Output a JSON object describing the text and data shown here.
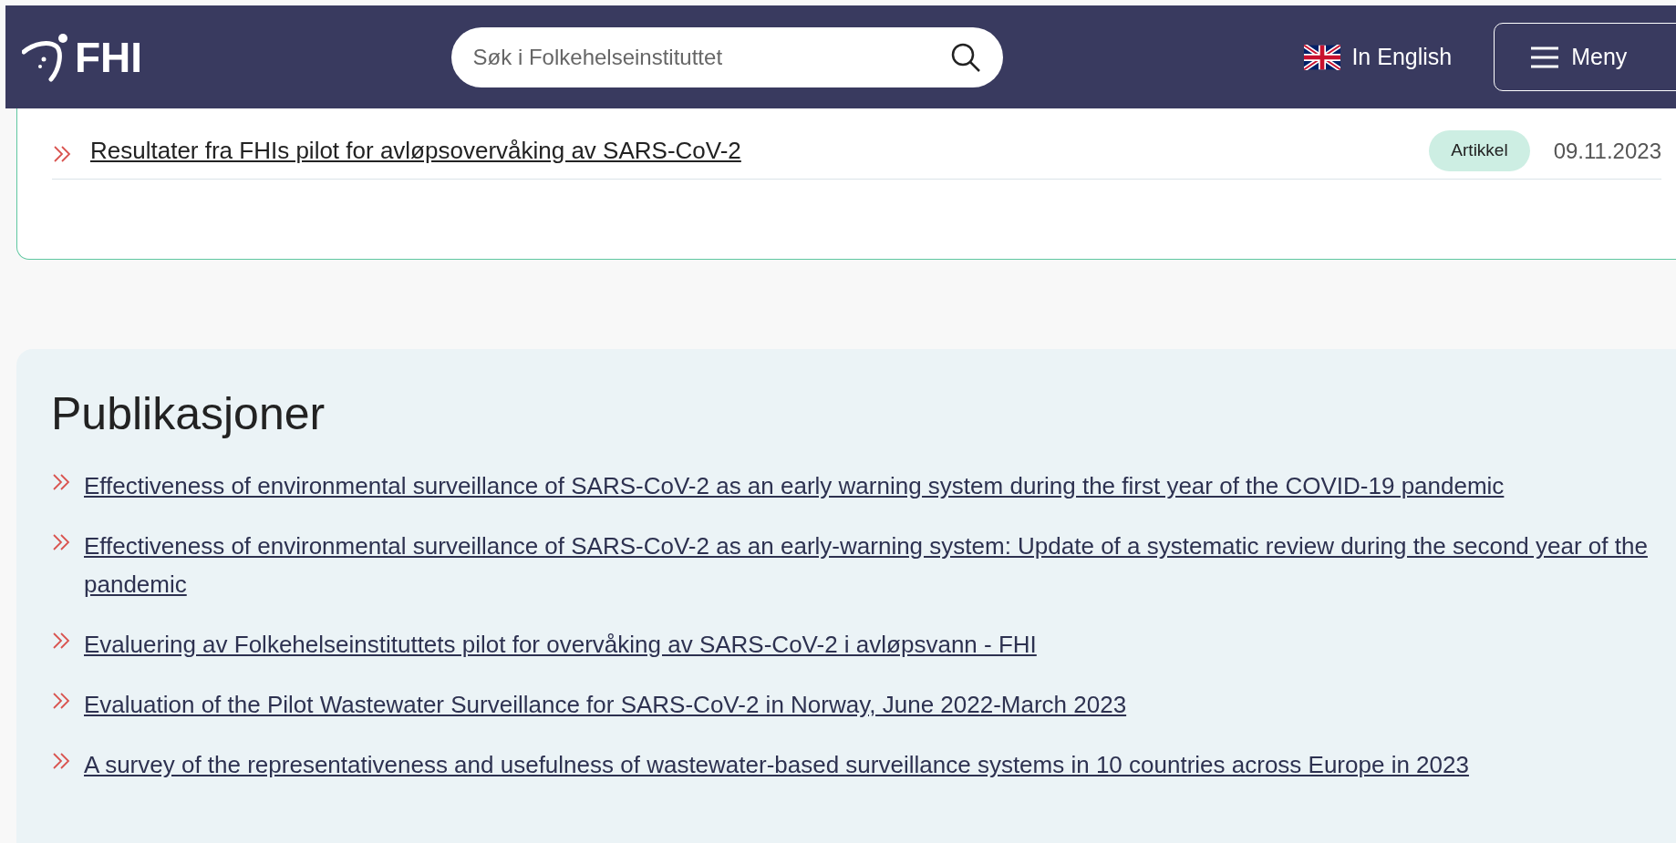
{
  "header": {
    "logo": "FHI",
    "search": {
      "placeholder": "Søk i Folkehelseinstituttet"
    },
    "language_link": "In English",
    "menu_button": "Meny"
  },
  "news_list": {
    "items": [
      {
        "title": "Resultater fra FHIs pilot for avløpsovervåking av SARS-CoV-2",
        "tag": "Artikkel",
        "date": "09.11.2023"
      }
    ]
  },
  "publications": {
    "title": "Publikasjoner",
    "links": [
      "Effectiveness of environmental surveillance of SARS-CoV-2 as an early warning system during the first year of the COVID-19 pandemic",
      "Effectiveness of environmental surveillance of SARS-CoV-2 as an early-warning system: Update of a systematic review during the second year of the pandemic",
      "Evaluering av Folkehelseinstituttets pilot for overvåking av SARS-CoV-2 i avløpsvann - FHI",
      "Evaluation of the Pilot Wastewater Surveillance for SARS-CoV-2 in Norway, June 2022-March 2023",
      "A survey of the representativeness and usefulness of wastewater-based surveillance systems in 10 countries across Europe in 2023"
    ]
  }
}
